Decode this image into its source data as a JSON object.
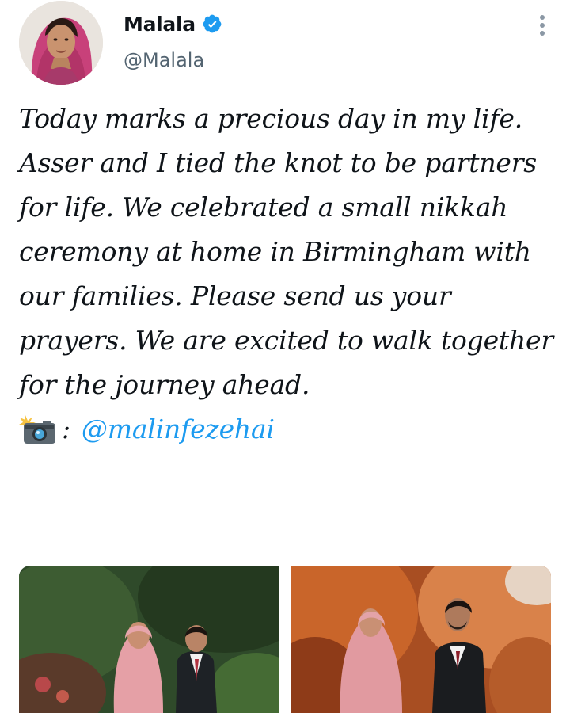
{
  "tweet": {
    "author": {
      "display_name": "Malala",
      "handle": "@Malala",
      "verified": true
    },
    "text_lines": [
      "Today marks a precious day in my life.",
      "Asser and I tied the knot to be partners for life. We celebrated a small nikkah ceremony at home in Birmingham with our families. Please send us your prayers. We are excited to walk together for the journey ahead."
    ],
    "photo_credit": {
      "icon": "camera-flash-icon",
      "separator": ":",
      "mention": "@malinfezehai"
    },
    "photos": [
      {
        "name": "wedding-photo-garden"
      },
      {
        "name": "wedding-photo-autumn"
      }
    ]
  },
  "colors": {
    "text": "#0f1419",
    "secondary_text": "#536471",
    "link": "#1d9bf0",
    "verified_badge": "#1d9bf0"
  }
}
